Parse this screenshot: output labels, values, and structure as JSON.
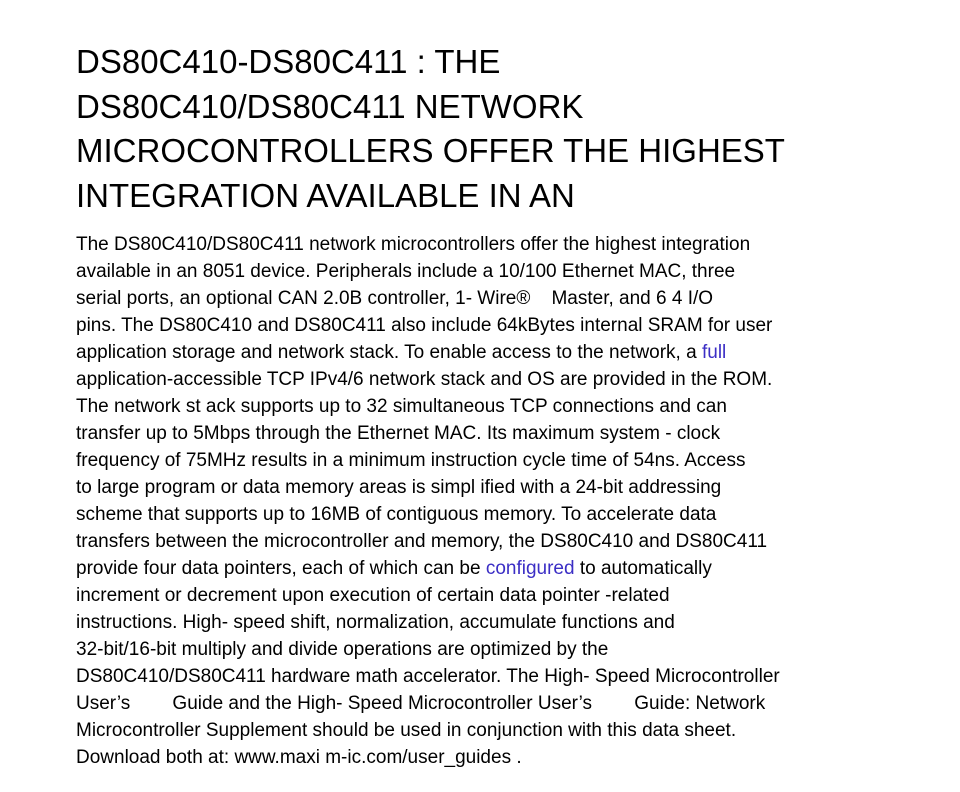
{
  "title_lines": [
    "DS80C410-DS80C411 : THE",
    "DS80C410/DS80C411 NETWORK",
    "MICROCONTROLLERS OFFER THE HIGHEST",
    "INTEGRATION AVAILABLE IN AN"
  ],
  "body": {
    "l1": "The DS80C410/DS80C411 network microcontrollers offer the highest integration",
    "l2": "available in an 8051 device. Peripherals include a 10/100 Ethernet MAC, three",
    "l3": "serial ports, an optional CAN 2.0B controller, 1- Wire®    Master, and 6 4 I/O",
    "l4": "pins. The DS80C410 and DS80C411 also include 64kBytes internal SRAM for user",
    "l5_pre": "application storage and network stack. To enable access to the network, a ",
    "l5_link": "full",
    "l6": "application-accessible TCP IPv4/6 network stack and OS are provided in the ROM.",
    "l7": "The network st ack supports up to 32 simultaneous TCP connections and can",
    "l8": "transfer up to 5Mbps through the Ethernet MAC. Its maximum system - clock",
    "l9": "frequency of 75MHz results in a minimum instruction cycle time of 54ns. Access",
    "l10": "to large program or data memory areas is simpl ified with a 24-bit addressing",
    "l11": "scheme that supports up to 16MB of contiguous memory. To accelerate data",
    "l12": "transfers between the microcontroller and memory, the DS80C410 and DS80C411",
    "l13_pre": "provide four data pointers, each of which can be ",
    "l13_link": "configured",
    "l13_post": " to automatically",
    "l14": "increment or decrement upon execution of certain data pointer -related",
    "l15": "instructions. High- speed shift, normalization, accumulate functions and",
    "l16": "32-bit/16-bit multiply and divide operations are optimized by the",
    "l17": "DS80C410/DS80C411 hardware math accelerator. The High- Speed Microcontroller",
    "l18": "User’s        Guide and the High- Speed Microcontroller User’s        Guide: Network",
    "l19": "Microcontroller Supplement should be used in conjunction with this data sheet.",
    "l20": "Download both at: www.maxi m-ic.com/user_guides ."
  },
  "colors": {
    "text": "#000000",
    "link": "#3b2ec5",
    "background": "#ffffff"
  }
}
